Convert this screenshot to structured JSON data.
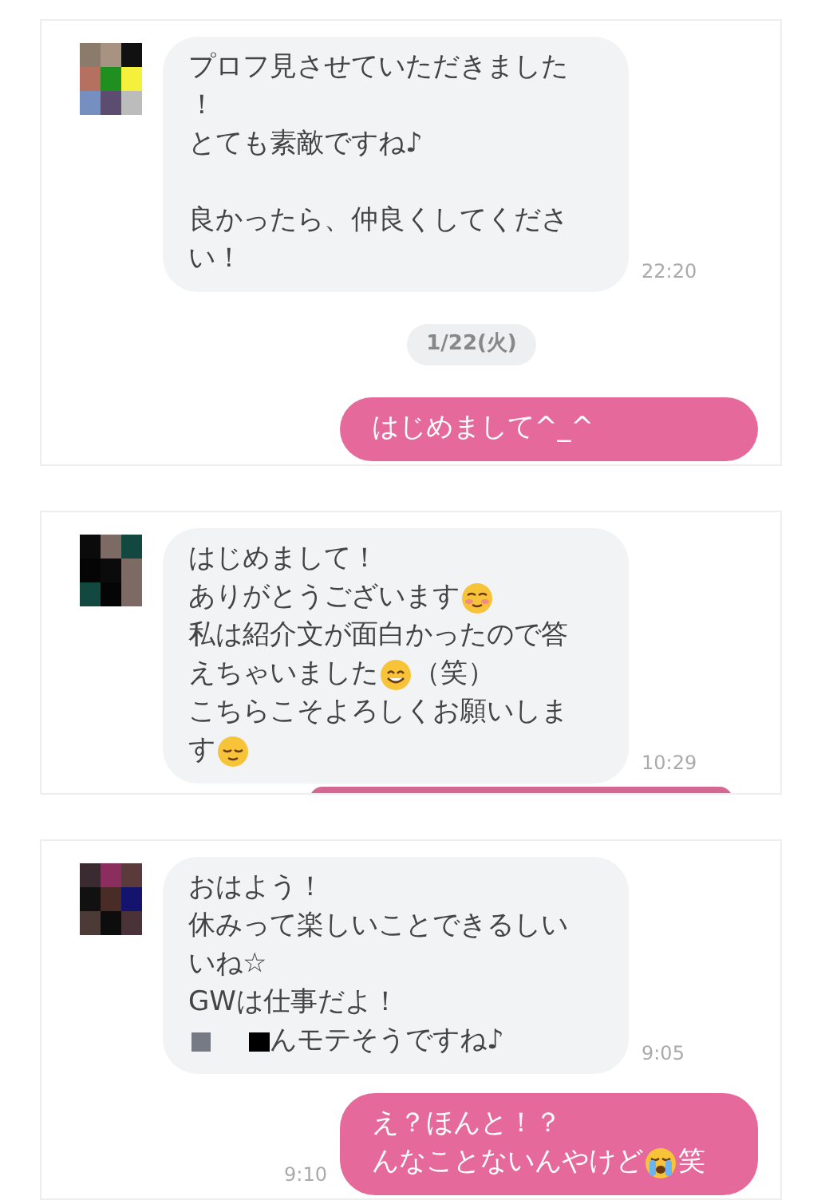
{
  "panels": [
    {
      "avatar": {
        "kind": "picture"
      },
      "messages": [
        {
          "kind": "received",
          "time": "22:20",
          "lines": [
            [
              {
                "kind": "text",
                "text": "プロフ見させていただきました"
              }
            ],
            [
              {
                "kind": "text",
                "text": "！"
              }
            ],
            [
              {
                "kind": "text",
                "text": "とても素敵ですね♪"
              }
            ],
            [
              {
                "kind": "paragraph-break"
              },
              {
                "kind": "text",
                "text": "良かったら、仲良くしてくださ"
              }
            ],
            [
              {
                "kind": "text",
                "text": "い！"
              }
            ]
          ]
        },
        {
          "kind": "date",
          "text": "1/22(火)"
        },
        {
          "kind": "sent",
          "lines": [
            [
              {
                "kind": "text",
                "text": "はじめまして^_^"
              }
            ]
          ]
        }
      ]
    },
    {
      "avatar": {
        "kind": "picture"
      },
      "messages": [
        {
          "kind": "received",
          "time": "10:29",
          "lines": [
            [
              {
                "kind": "text",
                "text": "はじめまして！"
              }
            ],
            [
              {
                "kind": "text",
                "text": "ありがとうございます"
              },
              {
                "kind": "blush"
              }
            ],
            [
              {
                "kind": "text",
                "text": "私は紹介文が面白かったので答"
              }
            ],
            [
              {
                "kind": "text",
                "text": "えちゃいました"
              },
              {
                "kind": "smile"
              },
              {
                "kind": "text",
                "text": "（笑）"
              }
            ],
            [
              {
                "kind": "text",
                "text": "こちらこそよろしくお願いしま"
              }
            ],
            [
              {
                "kind": "text",
                "text": "す"
              },
              {
                "kind": "relieved"
              }
            ]
          ]
        },
        {
          "kind": "sent-edge"
        }
      ]
    },
    {
      "avatar": {
        "kind": "picture"
      },
      "messages": [
        {
          "kind": "received",
          "time": "9:05",
          "lines": [
            [
              {
                "kind": "text",
                "text": "おはよう！"
              }
            ],
            [
              {
                "kind": "text",
                "text": "休みって楽しいことできるしい"
              }
            ],
            [
              {
                "kind": "text",
                "text": "いね☆"
              }
            ],
            [
              {
                "kind": "text",
                "text": "GWは仕事だよ！"
              }
            ],
            [
              {
                "kind": "redact-gray"
              },
              {
                "kind": "redact-black"
              },
              {
                "kind": "text",
                "text": "んモテそうですね♪"
              }
            ]
          ]
        },
        {
          "kind": "sent",
          "time": "9:10",
          "lines": [
            [
              {
                "kind": "text",
                "text": "え？ほんと！？"
              }
            ],
            [
              {
                "kind": "text",
                "text": "んなことないんやけど"
              },
              {
                "kind": "crying"
              },
              {
                "kind": "text",
                "text": "笑"
              }
            ]
          ]
        }
      ]
    }
  ]
}
